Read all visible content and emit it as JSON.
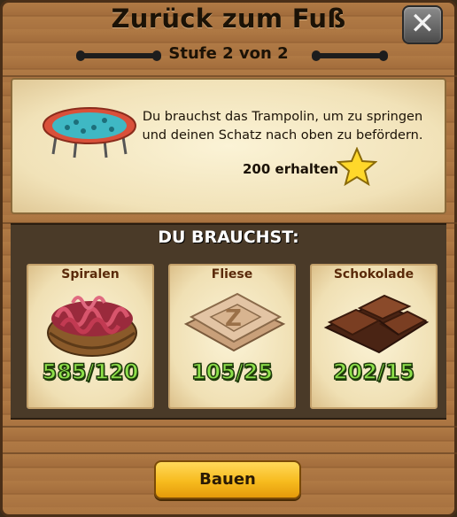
{
  "dialog": {
    "title": "Zurück zum Fuß",
    "stage": "Stufe 2 von 2",
    "close_icon": "close-icon"
  },
  "info": {
    "description": "Du brauchst das Trampolin, um zu springen und deinen Schatz nach oben zu befördern.",
    "reward_label": "200 erhalten",
    "reward_icon": "star-icon",
    "item_icon": "trampoline-icon"
  },
  "needs": {
    "title": "DU BRAUCHST:",
    "items": [
      {
        "name": "Spiralen",
        "count": "585/120",
        "icon": "spiral-basket-icon"
      },
      {
        "name": "Fliese",
        "count": "105/25",
        "icon": "tile-icon"
      },
      {
        "name": "Schokolade",
        "count": "202/15",
        "icon": "chocolate-icon"
      }
    ]
  },
  "actions": {
    "build_label": "Bauen"
  },
  "colors": {
    "count_green": "#8ee04a",
    "button_yellow": "#f7bb1e",
    "wood": "#a87240"
  }
}
